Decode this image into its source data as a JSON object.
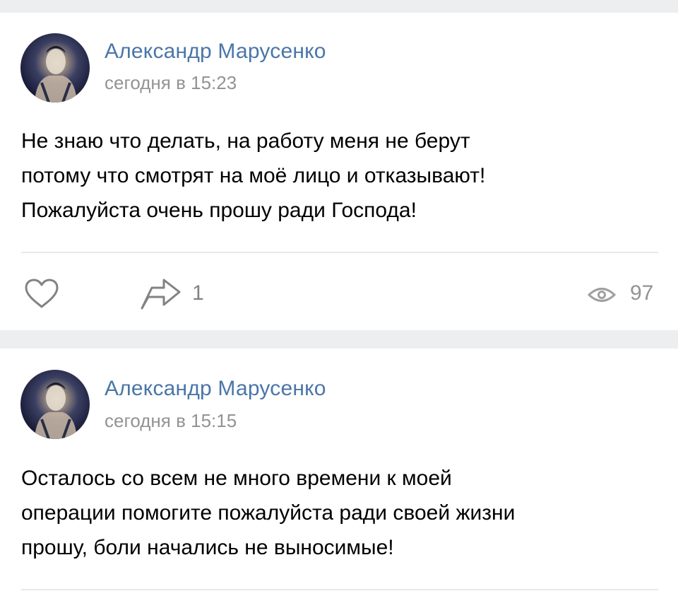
{
  "posts": [
    {
      "author": "Александр Марусенко",
      "timestamp": "сегодня в 15:23",
      "text_lines": [
        "Не знаю что делать, на работу меня не берут",
        "потому что смотрят на моё лицо и отказывают!",
        "Пожалуйста очень прошу ради Господа!"
      ],
      "share_count": "1",
      "views_count": "97",
      "icons": [
        "heart-icon",
        "share-arrow-icon",
        "eye-icon"
      ]
    },
    {
      "author": "Александр Марусенко",
      "timestamp": "сегодня в 15:15",
      "text_lines": [
        "Осталось со всем не много времени к моей",
        "операции помогите пожалуйста ради своей жизни",
        "прошу, боли начались не выносимые!"
      ]
    }
  ],
  "colors": {
    "author_link": "#4a76a8",
    "meta_gray": "#939393",
    "icon_gray": "#828282",
    "background": "#edeef0",
    "card": "#ffffff",
    "divider": "#e7e8ec"
  }
}
